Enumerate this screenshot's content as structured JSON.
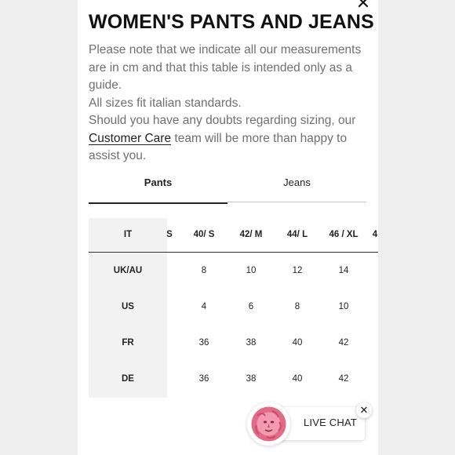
{
  "modal": {
    "close_icon": "close-icon",
    "title": "WOMEN'S PANTS AND JEANS",
    "intro_line1": "Please note that we indicate all our measurements are in cm and that this table is intended only as a guide.",
    "intro_line2": "All sizes fit italian standards.",
    "intro_line3_prefix": "Should you have any doubts regarding sizing, our",
    "intro_link": "Customer Care",
    "intro_line3_suffix": "team will be more than happy to assist you."
  },
  "tabs": [
    {
      "label": "Pants",
      "active": true
    },
    {
      "label": "Jeans",
      "active": false
    }
  ],
  "size_table": {
    "header": [
      "IT",
      "S",
      "40/ S",
      "42/ M",
      "44/ L",
      "46 / XL",
      "4"
    ],
    "rows": [
      {
        "label": "UK/AU",
        "values": [
          "8",
          "10",
          "12",
          "14"
        ]
      },
      {
        "label": "US",
        "values": [
          "4",
          "6",
          "8",
          "10"
        ]
      },
      {
        "label": "FR",
        "values": [
          "36",
          "38",
          "40",
          "42"
        ]
      },
      {
        "label": "DE",
        "values": [
          "36",
          "38",
          "40",
          "42"
        ]
      }
    ]
  },
  "live_chat": {
    "label": "LIVE CHAT",
    "avatar_icon": "medusa-logo-icon",
    "close_icon": "close-icon"
  },
  "colors": {
    "background": "#efefef",
    "panel": "#ffffff",
    "text": "#111111",
    "muted_text": "#707070",
    "table_first_col": "#f2f2f2",
    "avatar_pink": "#e36a86"
  }
}
